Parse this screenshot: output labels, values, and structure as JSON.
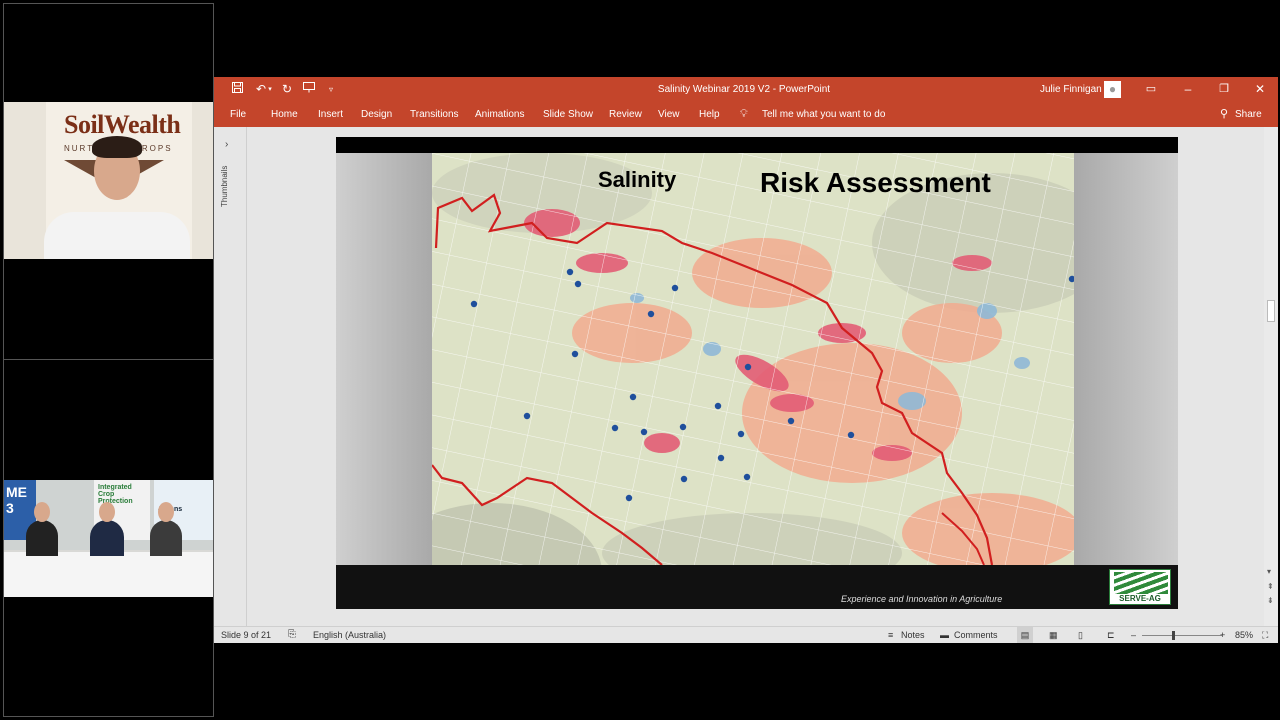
{
  "window": {
    "doc_title": "Salinity Webinar 2019 V2  -  PowerPoint",
    "user_name": "Julie Finnigan",
    "share_label": "Share"
  },
  "ribbon": {
    "tabs": [
      "File",
      "Home",
      "Insert",
      "Design",
      "Transitions",
      "Animations",
      "Slide Show",
      "Review",
      "View",
      "Help"
    ],
    "tell_me": "Tell me what you want to do"
  },
  "thumbnails": {
    "label": "Thumbnails"
  },
  "slide": {
    "title_left": "Salinity",
    "title_right": "Risk Assessment",
    "footer_tagline": "Experience and Innovation in Agriculture",
    "logo_text": "SERVE-AG"
  },
  "video": {
    "banner_brand": "SoilWealth",
    "banner_sub": "NURTURING CROPS",
    "room_posters": [
      "ME 3",
      "Integrated Crop Protection",
      "& Sons"
    ]
  },
  "status": {
    "slide_counter": "Slide 9 of 21",
    "language": "English (Australia)",
    "notes": "Notes",
    "comments": "Comments",
    "zoom": "85%"
  },
  "colors": {
    "accent": "#c4452b",
    "map_boundary": "#d11f1f",
    "map_points": "#1f4f9c"
  }
}
